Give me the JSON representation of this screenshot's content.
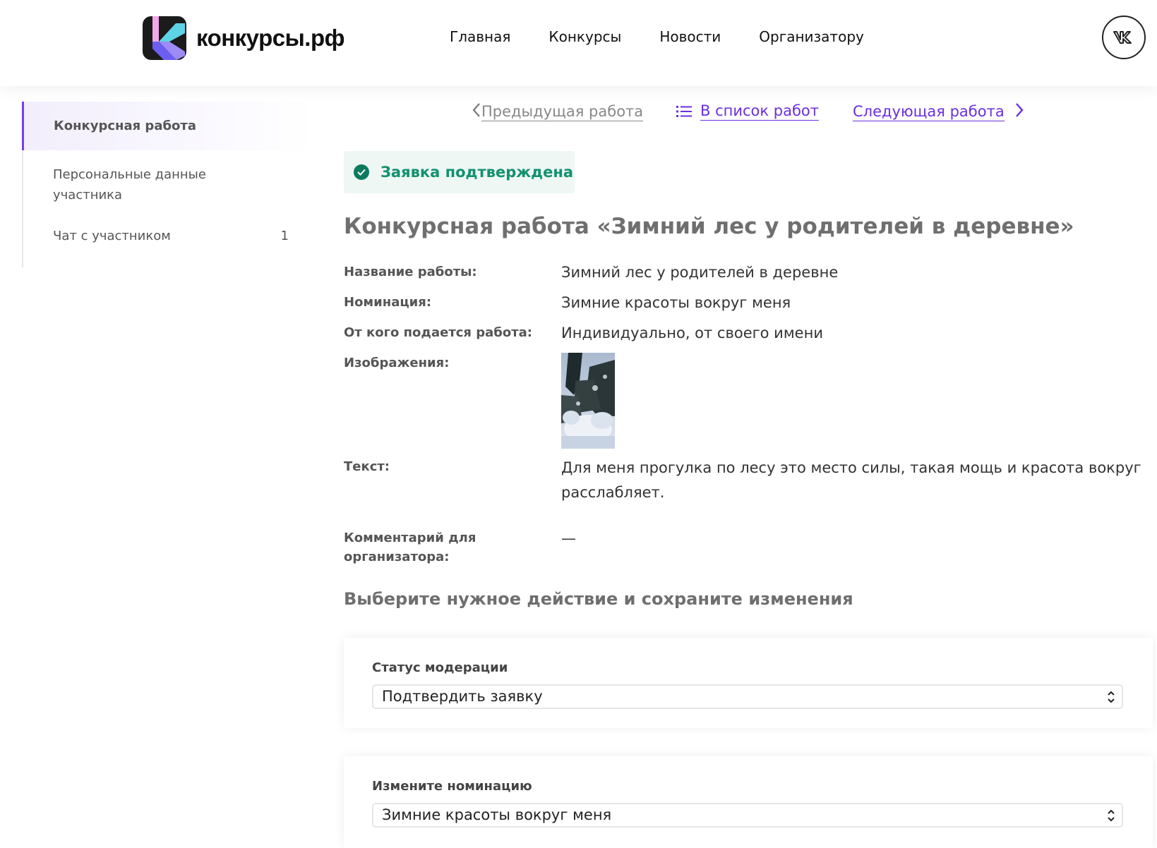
{
  "header": {
    "logo_text": "конкурсы.рф",
    "nav": [
      "Главная",
      "Конкурсы",
      "Новости",
      "Организатору"
    ],
    "social": "VK"
  },
  "sidebar": {
    "items": [
      {
        "label": "Конкурсная работа",
        "active": true
      },
      {
        "label": "Персональные данные участника"
      },
      {
        "label": "Чат с участником",
        "count": "1"
      }
    ]
  },
  "work_nav": {
    "prev": "Предыдущая работа",
    "list": "В список работ",
    "next": "Следующая работа"
  },
  "status": {
    "label": "Заявка подтверждена",
    "color": "#13916f"
  },
  "title": "Конкурсная работа «Зимний лес у родителей в деревне»",
  "details": {
    "name_label": "Название работы:",
    "name_value": "Зимний лес у родителей в деревне",
    "nomination_label": "Номинация:",
    "nomination_value": "Зимние красоты вокруг меня",
    "from_label": "От кого подается работа:",
    "from_value": "Индивидуально, от своего имени",
    "images_label": "Изображения:",
    "text_label": "Текст:",
    "text_value_1": "Для меня прогулка по лесу это место силы, такая мощь и красота вокруг",
    "text_value_2": "расслабляет.",
    "comment_label_1": "Комментарий для",
    "comment_label_2": "организатора:",
    "comment_value": "—"
  },
  "actions": {
    "title": "Выберите нужное действие и сохраните изменения",
    "moderation_label": "Статус модерации",
    "moderation_value": "Подтвердить заявку",
    "nomination_label": "Измените номинацию",
    "nomination_value": "Зимние красоты вокруг меня"
  },
  "colors": {
    "accent": "#6b2fe0",
    "success": "#13916f"
  }
}
